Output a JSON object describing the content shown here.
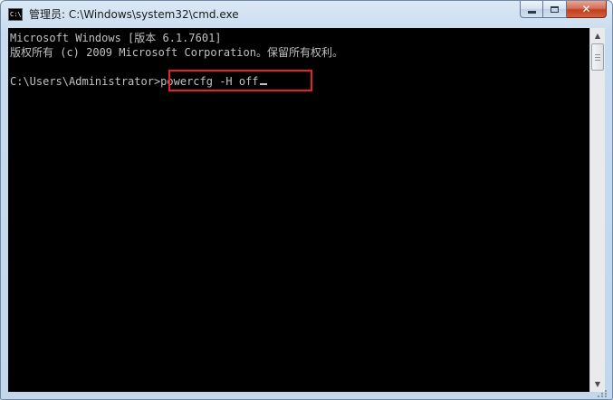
{
  "window": {
    "title": "管理员: C:\\Windows\\system32\\cmd.exe",
    "icon_text": "C:\\"
  },
  "console": {
    "lines": [
      "Microsoft Windows [版本 6.1.7601]",
      "版权所有 (c) 2009 Microsoft Corporation。保留所有权利。",
      "",
      "C:\\Users\\Administrator>powercfg -H off"
    ]
  },
  "colors": {
    "console_bg": "#000000",
    "console_text": "#c0c0c0",
    "highlight_border": "#e8202a",
    "close_button": "#c7462a"
  },
  "icons": {
    "app": "cmd-console-icon",
    "minimize": "minimize-icon",
    "maximize": "maximize-icon",
    "close": "close-icon",
    "scroll_up": "scroll-up-arrow-icon",
    "scroll_down": "scroll-down-arrow-icon"
  }
}
